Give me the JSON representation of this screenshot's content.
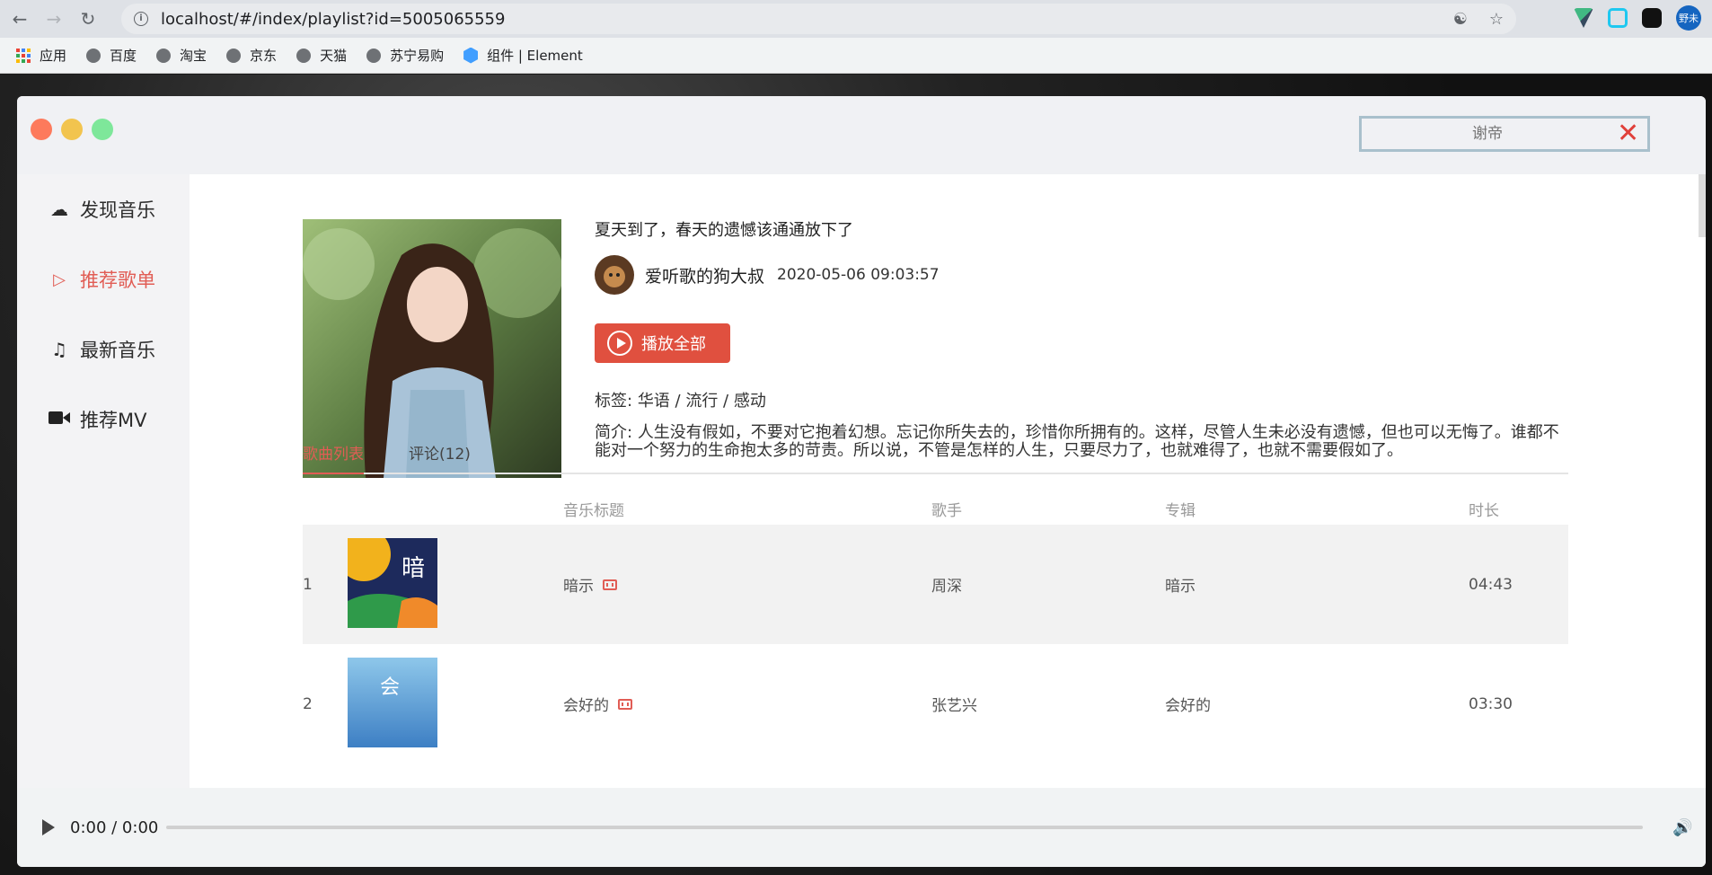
{
  "browser": {
    "url": "localhost/#/index/playlist?id=5005065559",
    "profile": "野未",
    "bookmarks": [
      "应用",
      "百度",
      "淘宝",
      "京东",
      "天猫",
      "苏宁易购",
      "组件 | Element"
    ]
  },
  "header": {
    "search_placeholder": "谢帝"
  },
  "sidebar": {
    "items": [
      {
        "label": "发现音乐",
        "icon": "cloud-icon",
        "active": false
      },
      {
        "label": "推荐歌单",
        "icon": "playstation-icon",
        "active": true
      },
      {
        "label": "最新音乐",
        "icon": "music-note-icon",
        "active": false
      },
      {
        "label": "推荐MV",
        "icon": "video-camera-icon",
        "active": false
      }
    ]
  },
  "playlist": {
    "title": "夏天到了，春天的遗憾该通通放下了",
    "creator": "爱听歌的狗大叔",
    "created_at": "2020-05-06 09:03:57",
    "play_all": "播放全部",
    "tags_label": "标签:",
    "tags": "华语 / 流行 / 感动",
    "desc_label": "简介:",
    "description": "人生没有假如，不要对它抱着幻想。忘记你所失去的，珍惜你所拥有的。这样，尽管人生未必没有遗憾，但也可以无悔了。谁都不能对一个努力的生命抱太多的苛责。所以说，不管是怎样的人生，只要尽力了，也就难得了，也就不需要假如了。"
  },
  "tabs": [
    "歌曲列表",
    "评论(12)"
  ],
  "table": {
    "headers": {
      "title": "音乐标题",
      "artist": "歌手",
      "album": "专辑",
      "duration": "时长"
    },
    "rows": [
      {
        "index": "1",
        "title": "暗示",
        "artist": "周深",
        "album": "暗示",
        "duration": "04:43"
      },
      {
        "index": "2",
        "title": "会好的",
        "artist": "张艺兴",
        "album": "会好的",
        "duration": "03:30"
      }
    ]
  },
  "player": {
    "time": "0:00 / 0:00",
    "progress": 0
  },
  "colors": {
    "accent": "#e15d55",
    "play_button": "#e0503f"
  }
}
